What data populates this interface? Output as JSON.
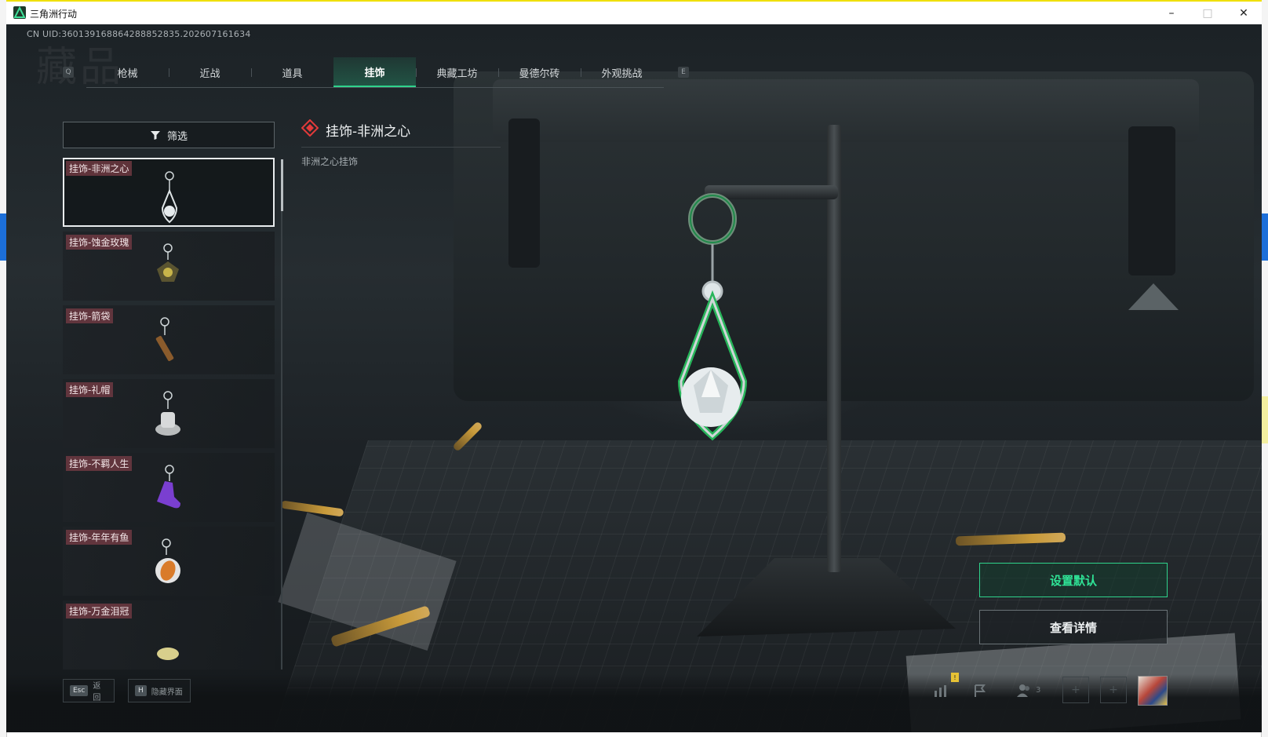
{
  "window": {
    "title": "三角洲行动",
    "minimize": "–",
    "maximize": "□",
    "close": "✕"
  },
  "header": {
    "uid": "CN UID:360139168864288852835.202607161634",
    "watermark": "藏品"
  },
  "tabs": {
    "prev_key": "Q",
    "next_key": "E",
    "items": [
      {
        "label": "枪械",
        "active": false
      },
      {
        "label": "近战",
        "active": false
      },
      {
        "label": "道具",
        "active": false
      },
      {
        "label": "挂饰",
        "active": true
      },
      {
        "label": "典藏工坊",
        "active": false
      },
      {
        "label": "曼德尔砖",
        "active": false
      },
      {
        "label": "外观挑战",
        "active": false
      }
    ]
  },
  "filter": {
    "label": "筛选"
  },
  "list": {
    "items": [
      {
        "label": "挂饰-非洲之心",
        "selected": true
      },
      {
        "label": "挂饰-蚀金玫瑰",
        "selected": false
      },
      {
        "label": "挂饰-箭袋",
        "selected": false
      },
      {
        "label": "挂饰-礼帽",
        "selected": false
      },
      {
        "label": "挂饰-不羁人生",
        "selected": false
      },
      {
        "label": "挂饰-年年有鱼",
        "selected": false
      },
      {
        "label": "挂饰-万金泪冠",
        "selected": false
      }
    ]
  },
  "detail": {
    "title": "挂饰-非洲之心",
    "description": "非洲之心挂饰"
  },
  "actions": {
    "set_default": "设置默认",
    "view_detail": "查看详情"
  },
  "bottom": {
    "esc_key": "Esc",
    "esc_label": "返回",
    "hide_key": "H",
    "hide_label": "隐藏界面",
    "team_count": "3",
    "alert_mark": "!"
  },
  "colors": {
    "accent": "#2fd38c",
    "tag_bg": "#783c46"
  }
}
